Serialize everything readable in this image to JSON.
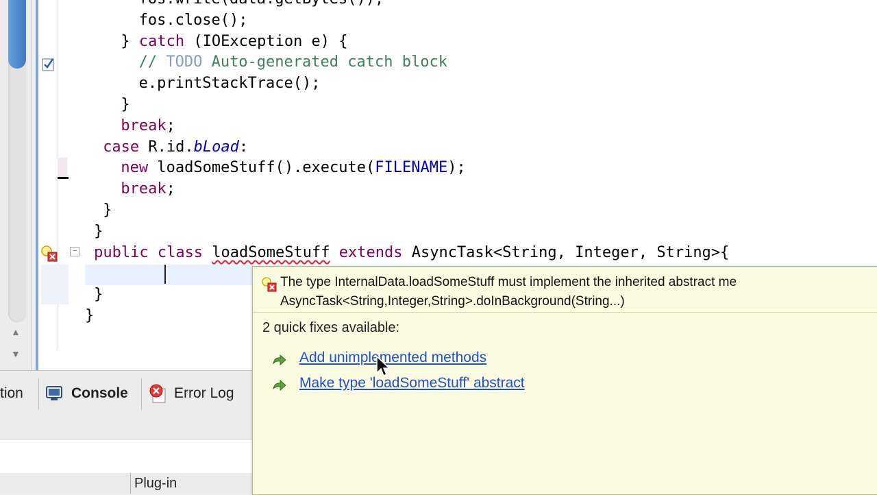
{
  "editor": {
    "lines": [
      {
        "indent": "            ",
        "parts": [
          {
            "t": "fos.write(data.getBytes());",
            "c": ""
          }
        ]
      },
      {
        "indent": "            ",
        "parts": [
          {
            "t": "fos.close();",
            "c": ""
          }
        ]
      },
      {
        "indent": "        ",
        "parts": [
          {
            "t": "} ",
            "c": ""
          },
          {
            "t": "catch",
            "c": "kw"
          },
          {
            "t": " (IOException e) {",
            "c": ""
          }
        ]
      },
      {
        "indent": "            ",
        "parts": [
          {
            "t": "// ",
            "c": "cm"
          },
          {
            "t": "TODO",
            "c": "todo"
          },
          {
            "t": " Auto-generated catch block",
            "c": "cm"
          }
        ]
      },
      {
        "indent": "            ",
        "parts": [
          {
            "t": "e.printStackTrace();",
            "c": ""
          }
        ]
      },
      {
        "indent": "        ",
        "parts": [
          {
            "t": "}",
            "c": ""
          }
        ]
      },
      {
        "indent": "        ",
        "parts": [
          {
            "t": "break",
            "c": "kw"
          },
          {
            "t": ";",
            "c": ""
          }
        ]
      },
      {
        "indent": "    ",
        "parts": [
          {
            "t": "case",
            "c": "kw"
          },
          {
            "t": " R.id.",
            "c": ""
          },
          {
            "t": "bLoad",
            "c": "ital"
          },
          {
            "t": ":",
            "c": ""
          }
        ]
      },
      {
        "indent": "        ",
        "parts": [
          {
            "t": "new",
            "c": "kw"
          },
          {
            "t": " loadSomeStuff().execute(",
            "c": ""
          },
          {
            "t": "FILENAME",
            "c": "fld"
          },
          {
            "t": ");",
            "c": ""
          }
        ]
      },
      {
        "indent": "        ",
        "parts": [
          {
            "t": "break",
            "c": "kw"
          },
          {
            "t": ";",
            "c": ""
          }
        ]
      },
      {
        "indent": "    ",
        "parts": [
          {
            "t": "}",
            "c": ""
          }
        ]
      },
      {
        "indent": "  ",
        "parts": [
          {
            "t": "}",
            "c": ""
          }
        ]
      },
      {
        "indent": "  ",
        "parts": [
          {
            "t": "public",
            "c": "kw"
          },
          {
            "t": " ",
            "c": ""
          },
          {
            "t": "class",
            "c": "kw"
          },
          {
            "t": " ",
            "c": ""
          },
          {
            "t": "loadSomeStuff",
            "c": "err"
          },
          {
            "t": " ",
            "c": ""
          },
          {
            "t": "extends",
            "c": "kw"
          },
          {
            "t": " AsyncTask<String, Integer, String>{",
            "c": ""
          }
        ]
      },
      {
        "indent": "",
        "parts": [
          {
            "t": "",
            "c": ""
          }
        ]
      },
      {
        "indent": "  ",
        "parts": [
          {
            "t": "}",
            "c": ""
          }
        ]
      },
      {
        "indent": "",
        "parts": [
          {
            "t": "}",
            "c": ""
          }
        ]
      }
    ]
  },
  "tabs": {
    "partial_label": "tion",
    "console_label": "Console",
    "errorlog_label": "Error Log"
  },
  "footer": {
    "plugin_label": "Plug-in"
  },
  "quickfix": {
    "message_line1": "The type InternalData.loadSomeStuff must implement the inherited abstract me",
    "message_line2": "AsyncTask<String,Integer,String>.doInBackground(String...)",
    "fixes_title": "2 quick fixes available:",
    "fixes": [
      {
        "label": "Add unimplemented methods"
      },
      {
        "label": "Make type 'loadSomeStuff' abstract"
      }
    ]
  },
  "colors": {
    "keyword": "#7f0055",
    "comment": "#3f7f5f",
    "link": "#1f4fd1",
    "popup_bg": "#fbfbe2",
    "selection_blue": "#3d78c4"
  }
}
